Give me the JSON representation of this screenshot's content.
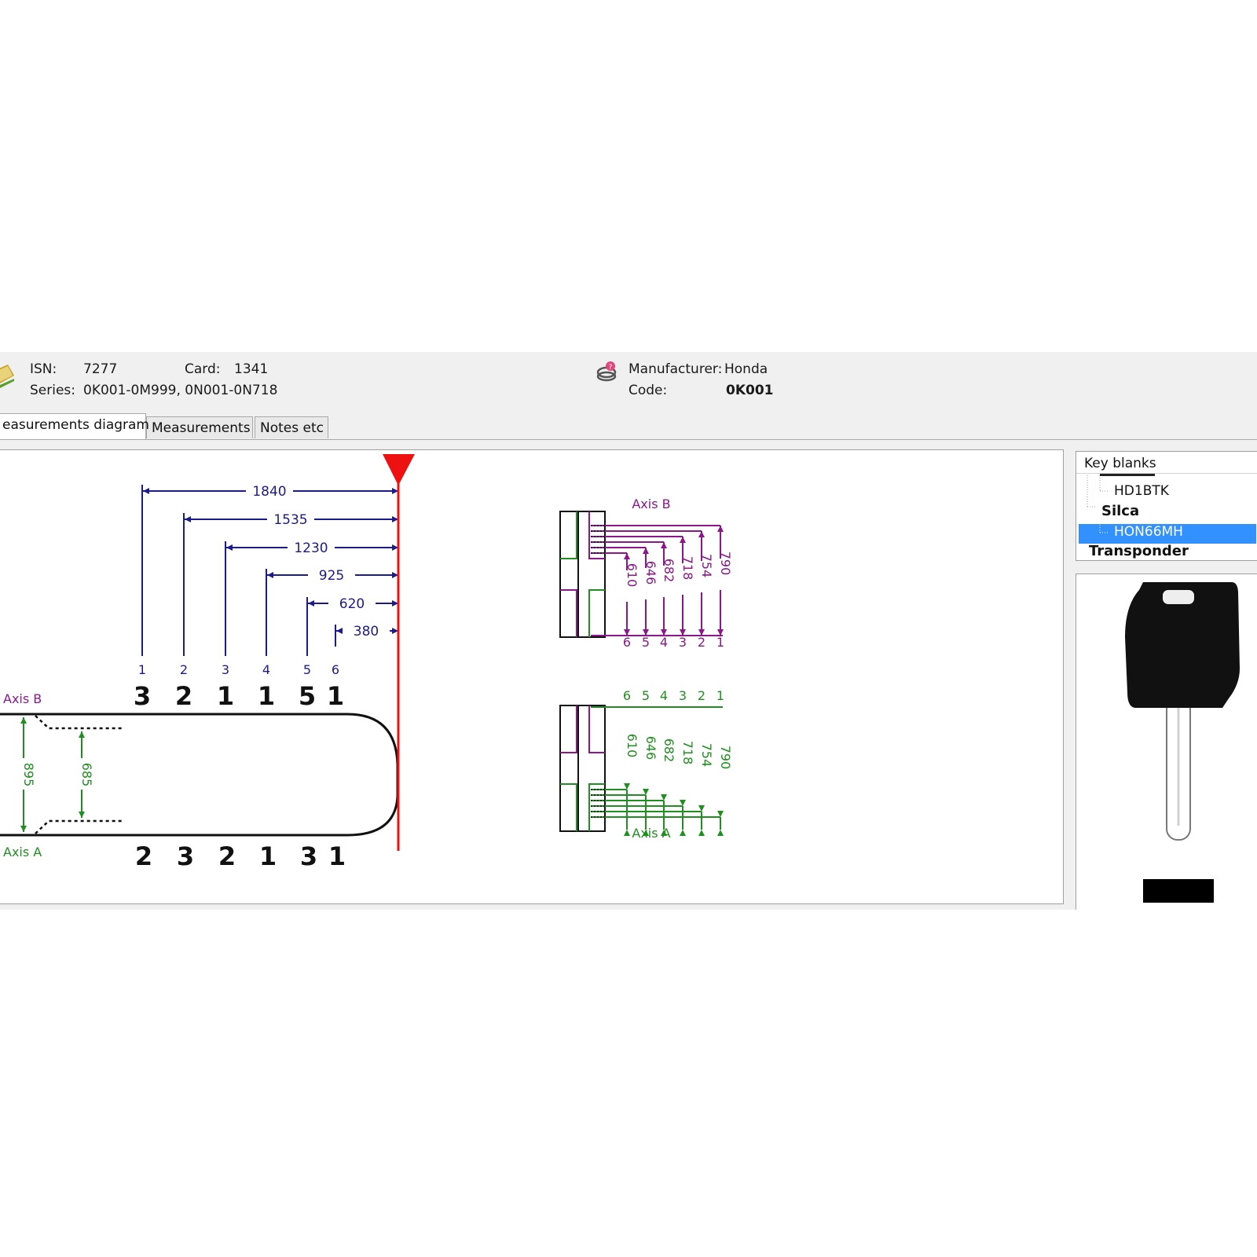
{
  "header": {
    "isn_label": "ISN:",
    "isn_value": "7277",
    "card_label": "Card:",
    "card_value": "1341",
    "series_label": "Series:",
    "series_value": "0K001-0M999, 0N001-0N718",
    "manufacturer_label": "Manufacturer:",
    "manufacturer_value": "Honda",
    "code_label": "Code:",
    "code_value": "0K001"
  },
  "tabs": [
    {
      "label": "easurements diagram",
      "active": true
    },
    {
      "label": "Measurements",
      "active": false
    },
    {
      "label": "Notes etc",
      "active": false
    }
  ],
  "diagram": {
    "stop_color": "#ee1111",
    "dim_color": "#1b1b8c",
    "axis_b_color": "#8b178b",
    "axis_a_color": "#1f8f1f",
    "spacing_dims": [
      "1840",
      "1535",
      "1230",
      "925",
      "620",
      "380"
    ],
    "cut_positions": [
      "1",
      "2",
      "3",
      "4",
      "5",
      "6"
    ],
    "axis_b_label": "Axis B",
    "axis_a_label": "Axis A",
    "axis_b_cuts": [
      "3",
      "2",
      "1",
      "1",
      "5",
      "1"
    ],
    "axis_a_cuts": [
      "2",
      "3",
      "2",
      "1",
      "3",
      "1"
    ],
    "blade_width_outer": "895",
    "blade_width_inner": "685",
    "depth_dims": [
      "610",
      "646",
      "682",
      "718",
      "754",
      "790"
    ],
    "depth_numbers_top": [
      "6",
      "5",
      "4",
      "3",
      "2",
      "1"
    ],
    "depth_numbers_bottom": [
      "6",
      "5",
      "4",
      "3",
      "2",
      "1"
    ]
  },
  "key_blanks": {
    "header": "Key blanks",
    "items": [
      {
        "label": "HD1BTK",
        "bold": false,
        "selected": false
      },
      {
        "label": "Silca",
        "bold": true,
        "selected": false
      },
      {
        "label": "HON66MH",
        "bold": false,
        "selected": true
      },
      {
        "label": "Transponder",
        "bold": true,
        "selected": false
      }
    ]
  }
}
